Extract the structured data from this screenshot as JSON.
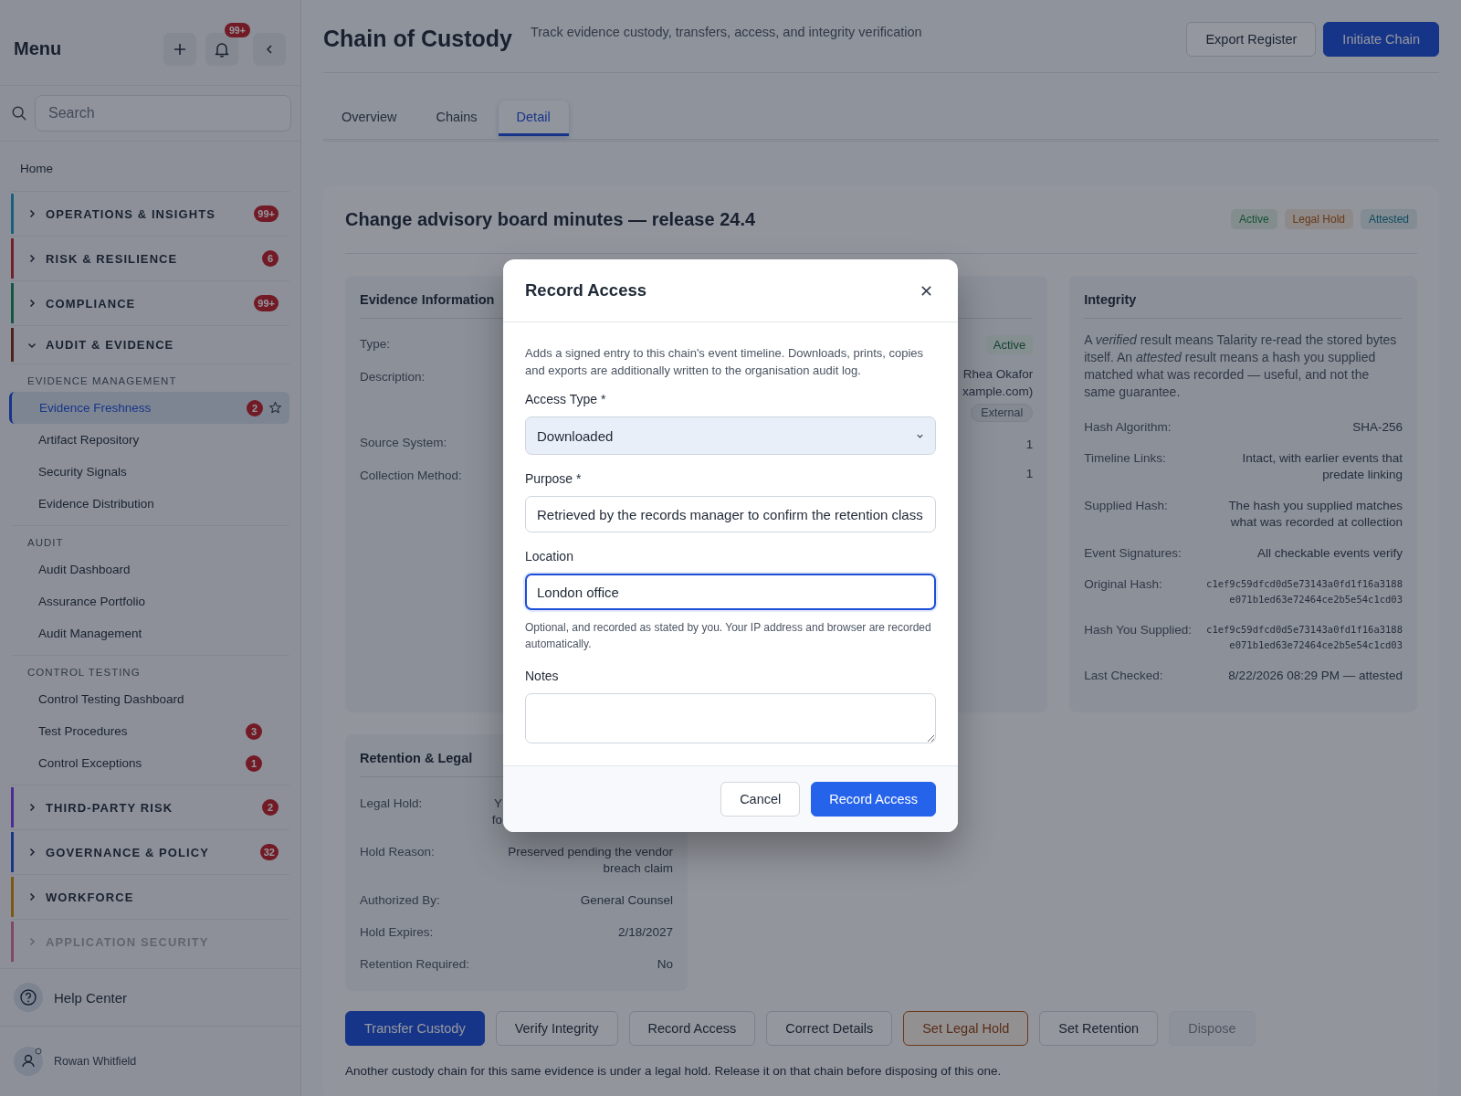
{
  "sidebar": {
    "title": "Menu",
    "notification_count": "99+",
    "search": {
      "placeholder": "Search"
    },
    "home": "Home",
    "sections": [
      {
        "label": "OPERATIONS & INSIGHTS",
        "color": "#17617c",
        "badge": "99+",
        "expanded": false,
        "dimmed": false
      },
      {
        "label": "RISK & RESILIENCE",
        "color": "#73202b",
        "badge": "6",
        "expanded": false,
        "dimmed": false
      },
      {
        "label": "COMPLIANCE",
        "color": "#125543",
        "badge": "99+",
        "expanded": false,
        "dimmed": false
      },
      {
        "label": "AUDIT & EVIDENCE",
        "color": "#4c241b",
        "expanded": true,
        "dimmed": false,
        "groups": [
          {
            "heading": "EVIDENCE MANAGEMENT",
            "items": [
              {
                "label": "Evidence Freshness",
                "selected": true,
                "badge": "2"
              },
              {
                "label": "Artifact Repository",
                "selected": false
              },
              {
                "label": "Security Signals",
                "selected": false
              },
              {
                "label": "Evidence Distribution",
                "selected": false
              }
            ]
          },
          {
            "heading": "AUDIT",
            "items": [
              {
                "label": "Audit Dashboard",
                "selected": false
              },
              {
                "label": "Assurance Portfolio",
                "selected": false
              },
              {
                "label": "Audit Management",
                "selected": false
              }
            ]
          },
          {
            "heading": "CONTROL TESTING",
            "items": [
              {
                "label": "Control Testing Dashboard",
                "selected": false
              },
              {
                "label": "Test Procedures",
                "selected": false,
                "badge": "3"
              },
              {
                "label": "Control Exceptions",
                "selected": false,
                "badge": "1"
              }
            ]
          }
        ]
      },
      {
        "label": "THIRD-PARTY RISK",
        "color": "#4c2b94",
        "badge": "2",
        "expanded": false,
        "dimmed": false
      },
      {
        "label": "GOVERNANCE & POLICY",
        "color": "#183688",
        "badge": "32",
        "expanded": false,
        "dimmed": false
      },
      {
        "label": "WORKFORCE",
        "color": "#7f5715",
        "expanded": false,
        "dimmed": false
      },
      {
        "label": "APPLICATION SECURITY",
        "color": "#804862",
        "expanded": false,
        "dimmed": true
      }
    ],
    "help": "Help Center",
    "user": "Rowan Whitfield"
  },
  "header": {
    "title": "Chain of Custody",
    "subtitle": "Track evidence custody, transfers, access, and integrity verification",
    "buttons": [
      {
        "label": "Export Register",
        "kind": "secondary"
      },
      {
        "label": "Initiate Chain",
        "kind": "primary"
      }
    ]
  },
  "tabs": [
    {
      "label": "Overview",
      "selected": false
    },
    {
      "label": "Chains",
      "selected": false
    },
    {
      "label": "Detail",
      "selected": true
    }
  ],
  "record": {
    "title": "Change advisory board minutes — release 24.4",
    "badges": [
      {
        "label": "Active",
        "color": "#135133"
      },
      {
        "label": "Legal Hold",
        "color": "#6b3817"
      },
      {
        "label": "Attested",
        "color": "#0f4b61"
      }
    ],
    "evidence_panel": {
      "title": "Evidence Information",
      "rows": [
        {
          "label": "Type:"
        },
        {
          "label": "Description:"
        },
        {
          "label": "Source System:"
        },
        {
          "label": "Collection Method:"
        }
      ]
    },
    "custody_panel": {
      "status": "Active",
      "owner_lines": [
        "Rhea Okafor",
        "xample.com)"
      ],
      "tag": "External",
      "values": [
        "1",
        "1"
      ]
    },
    "integrity_panel": {
      "title": "Integrity",
      "note": "A *verified* result means Talarity re-read the stored bytes itself. An *attested* result means a hash you supplied matched what was recorded — useful, and not the same guarantee.",
      "rows": [
        {
          "label": "Hash Algorithm:",
          "kind": "text",
          "lines": [
            "SHA-256"
          ]
        },
        {
          "label": "Timeline Links:",
          "kind": "text",
          "lines": [
            "Intact, with earlier events that predate linking"
          ]
        },
        {
          "label": "Supplied Hash:",
          "kind": "text",
          "lines": [
            "The hash you supplied matches what was recorded at collection"
          ]
        },
        {
          "label": "Event Signatures:",
          "kind": "text",
          "lines": [
            "All checkable events verify"
          ]
        },
        {
          "label": "Original Hash:",
          "kind": "hash",
          "lines": [
            "c1ef9c59dfcd0d5e73143a0fd1f16a3188",
            "e071b1ed63e72464ce2b5e54c1cd03"
          ]
        },
        {
          "label": "Hash You Supplied:",
          "kind": "hash",
          "lines": [
            "c1ef9c59dfcd0d5e73143a0fd1f16a3188",
            "e071b1ed63e72464ce2b5e54c1cd03"
          ]
        },
        {
          "label": "Last Checked:",
          "kind": "text",
          "lines": [
            "8/22/2026 08:29 PM — attested"
          ]
        }
      ]
    },
    "retention_panel": {
      "title": "Retention & Legal",
      "rows": [
        {
          "label": "Legal Hold:",
          "kind": "partial",
          "lines": [
            "Y",
            "fo"
          ]
        },
        {
          "label": "Hold Reason:",
          "kind": "text",
          "lines": [
            "Preserved pending the vendor breach claim"
          ]
        },
        {
          "label": "Authorized By:",
          "kind": "text",
          "lines": [
            "General Counsel"
          ]
        },
        {
          "label": "Hold Expires:",
          "kind": "text",
          "lines": [
            "2/18/2027"
          ]
        },
        {
          "label": "Retention Required:",
          "kind": "text",
          "lines": [
            "No"
          ]
        }
      ]
    },
    "actions": [
      {
        "label": "Transfer Custody",
        "kind": "primary"
      },
      {
        "label": "Verify Integrity",
        "kind": "secondary"
      },
      {
        "label": "Record Access",
        "kind": "secondary"
      },
      {
        "label": "Correct Details",
        "kind": "secondary"
      },
      {
        "label": "Set Legal Hold",
        "kind": "warning"
      },
      {
        "label": "Set Retention",
        "kind": "secondary"
      },
      {
        "label": "Dispose",
        "kind": "disabled"
      }
    ],
    "notice": "Another custody chain for this same evidence is under a legal hold. Release it on that chain before disposing of this one."
  },
  "modal": {
    "title": "Record Access",
    "description": "Adds a signed entry to this chain's event timeline. Downloads, prints, copies and exports are additionally written to the organisation audit log.",
    "fields": [
      {
        "kind": "select",
        "label": "Access Type *",
        "value": "Downloaded"
      },
      {
        "kind": "input",
        "label": "Purpose *",
        "value": "Retrieved by the records manager to confirm the retention class",
        "focused": false
      },
      {
        "kind": "input",
        "label": "Location",
        "value": "London office",
        "focused": true,
        "help": "Optional, and recorded as stated by you. Your IP address and browser are recorded automatically."
      },
      {
        "kind": "textarea",
        "label": "Notes"
      }
    ],
    "buttons": [
      {
        "label": "Cancel",
        "kind": "secondary"
      },
      {
        "label": "Record Access",
        "kind": "primary"
      }
    ]
  }
}
